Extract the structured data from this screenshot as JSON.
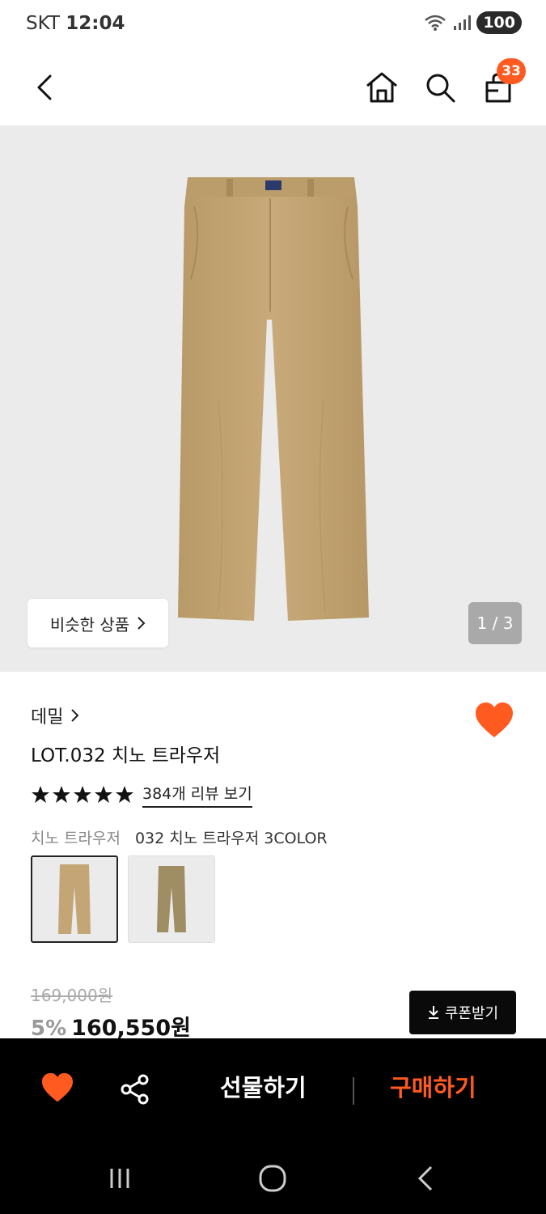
{
  "status_bar": {
    "carrier": "SKT",
    "time": "12:04",
    "battery": "100"
  },
  "nav": {
    "cart_count": "33"
  },
  "hero": {
    "similar_label": "비슷한 상품",
    "page_indicator": "1 / 3"
  },
  "product": {
    "brand": "데밀",
    "title": "LOT.032 치노 트라우저",
    "rating_stars": 5,
    "review_link": "384개 리뷰 보기",
    "variant_label": "치노 트라우저",
    "variant_name": "032 치노 트라우저 3COLOR",
    "original_price": "169,000원",
    "discount": "5%",
    "sale_price": "160,550원",
    "coupon_label": "쿠폰받기"
  },
  "actions": {
    "gift_label": "선물하기",
    "buy_label": "구매하기"
  },
  "colors": {
    "accent": "#ff5a1f",
    "pants": "#c4a676"
  }
}
